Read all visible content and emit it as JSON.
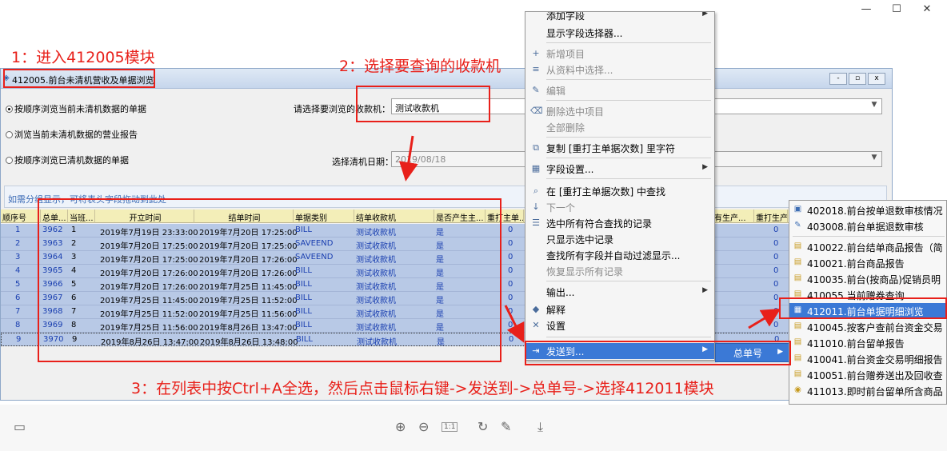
{
  "annotations": {
    "step1": "1：进入412005模块",
    "step2": "2：选择要查询的收款机",
    "step3": "3：在列表中按Ctrl+A全选，然后点击鼠标右键->发送到->总单号->选择412011模块"
  },
  "window": {
    "title": "412005.前台未清机营收及单据浏览",
    "controls": [
      "-",
      "▫",
      "x"
    ]
  },
  "options": {
    "radio1": "按顺序浏览当前未清机数据的单据",
    "radio2": "浏览当前未清机数据的营业报告",
    "radio3": "按顺序浏览已清机数据的单据",
    "register_label": "请选择要浏览的收款机：",
    "register_value": "测试收款机",
    "date_label": "选择清机日期：",
    "date_value": "2019/08/18"
  },
  "group_hint": "如需分组显示，可将表头字段拖动到此处",
  "grid": {
    "headers": [
      "顺序号",
      "总单...",
      "当班...",
      "开立时间",
      "结单时间",
      "单据类别",
      "结单收款机",
      "是否产生主...",
      "重打主单...",
      "有生产...",
      "重打生产..."
    ],
    "rows": [
      [
        "1",
        "3962",
        "1",
        "2019年7月19日 23:33:00",
        "2019年7月20日 17:25:00",
        "BILL",
        "测试收款机",
        "是",
        "0",
        "0"
      ],
      [
        "2",
        "3963",
        "2",
        "2019年7月20日 17:25:00",
        "2019年7月20日 17:25:00",
        "SAVEEND",
        "测试收款机",
        "是",
        "0",
        "0"
      ],
      [
        "3",
        "3964",
        "3",
        "2019年7月20日 17:25:00",
        "2019年7月20日 17:26:00",
        "SAVEEND",
        "测试收款机",
        "是",
        "0",
        "0"
      ],
      [
        "4",
        "3965",
        "4",
        "2019年7月20日 17:26:00",
        "2019年7月20日 17:26:00",
        "BILL",
        "测试收款机",
        "是",
        "0",
        "0"
      ],
      [
        "5",
        "3966",
        "5",
        "2019年7月20日 17:26:00",
        "2019年7月25日 11:45:00",
        "BILL",
        "测试收款机",
        "是",
        "0",
        "0"
      ],
      [
        "6",
        "3967",
        "6",
        "2019年7月25日 11:45:00",
        "2019年7月25日 11:52:00",
        "BILL",
        "测试收款机",
        "是",
        "0",
        "0"
      ],
      [
        "7",
        "3968",
        "7",
        "2019年7月25日 11:52:00",
        "2019年7月25日 11:56:00",
        "BILL",
        "测试收款机",
        "是",
        "0",
        "0"
      ],
      [
        "8",
        "3969",
        "8",
        "2019年7月25日 11:56:00",
        "2019年8月26日 13:47:00",
        "BILL",
        "测试收款机",
        "是",
        "0",
        "0"
      ],
      [
        "9",
        "3970",
        "9",
        "2019年8月26日 13:47:00",
        "2019年8月26日 13:48:00",
        "BILL",
        "测试收款机",
        "是",
        "0",
        "0"
      ]
    ]
  },
  "context_menu": {
    "items": [
      {
        "label": "添加字段",
        "icon": "",
        "disabled": false,
        "sub": true
      },
      {
        "label": "显示字段选择器...",
        "icon": "",
        "disabled": false,
        "sub": false
      },
      {
        "label": "新增项目",
        "icon": "+",
        "disabled": true,
        "sub": false
      },
      {
        "label": "从资料中选择...",
        "icon": "≡",
        "disabled": true,
        "sub": false
      },
      {
        "label": "编辑",
        "icon": "✎",
        "disabled": true,
        "sub": false
      },
      {
        "label": "删除选中项目",
        "icon": "⌫",
        "disabled": true,
        "sub": false
      },
      {
        "label": "全部删除",
        "icon": "",
        "disabled": true,
        "sub": false
      },
      {
        "label": "复制 [重打主单据次数] 里字符",
        "icon": "⧉",
        "disabled": false,
        "sub": false
      },
      {
        "label": "字段设置...",
        "icon": "▦",
        "disabled": false,
        "sub": true
      },
      {
        "label": "在 [重打主单据次数] 中查找",
        "icon": "⌕",
        "disabled": false,
        "sub": false
      },
      {
        "label": "下一个",
        "icon": "↓",
        "disabled": true,
        "sub": false
      },
      {
        "label": "选中所有符合查找的记录",
        "icon": "☰",
        "disabled": false,
        "sub": false
      },
      {
        "label": "只显示选中记录",
        "icon": "",
        "disabled": false,
        "sub": false
      },
      {
        "label": "查找所有字段并自动过滤显示...",
        "icon": "",
        "disabled": false,
        "sub": false
      },
      {
        "label": "恢复显示所有记录",
        "icon": "",
        "disabled": true,
        "sub": false
      },
      {
        "label": "输出...",
        "icon": "",
        "disabled": false,
        "sub": true
      },
      {
        "label": "解释",
        "icon": "◆",
        "disabled": false,
        "sub": false
      },
      {
        "label": "设置",
        "icon": "✕",
        "disabled": false,
        "sub": false
      },
      {
        "label": "发送到...",
        "icon": "⇥",
        "disabled": false,
        "sub": true
      }
    ]
  },
  "submenu_send": {
    "label": "总单号"
  },
  "submenu_modules": {
    "items": [
      {
        "label": "402018.前台按单退数审核情况",
        "icon": "▣"
      },
      {
        "label": "403008.前台单据退数审核",
        "icon": "✎"
      },
      {
        "label": "410022.前台结单商品报告（简",
        "icon": "▤"
      },
      {
        "label": "410021.前台商品报告",
        "icon": "▤"
      },
      {
        "label": "410035.前台(按商品)促销员明",
        "icon": "▤"
      },
      {
        "label": "410055.当前赠券查询",
        "icon": "▤"
      },
      {
        "label": "412011.前台单据明细浏览",
        "icon": "▦"
      },
      {
        "label": "410045.按客户查前台资金交易",
        "icon": "▤"
      },
      {
        "label": "411010.前台留单报告",
        "icon": "▤"
      },
      {
        "label": "410041.前台资金交易明细报告",
        "icon": "▤"
      },
      {
        "label": "410051.前台赠券送出及回收查",
        "icon": "▤"
      },
      {
        "label": "411013.即时前台留单所含商品",
        "icon": "◉"
      }
    ]
  },
  "viewer_toolbar": {
    "icons": [
      "sidebar-icon",
      "zoom-in-icon",
      "zoom-out-icon",
      "fit-icon",
      "rotate-icon",
      "edit-icon",
      "download-icon"
    ],
    "fit_label": "1:1"
  },
  "colors": {
    "annotation_red": "#e8201a",
    "selection_blue": "#b8c9e6",
    "highlight_blue": "#3b79d6",
    "header_yellow": "#f3eeb8"
  }
}
